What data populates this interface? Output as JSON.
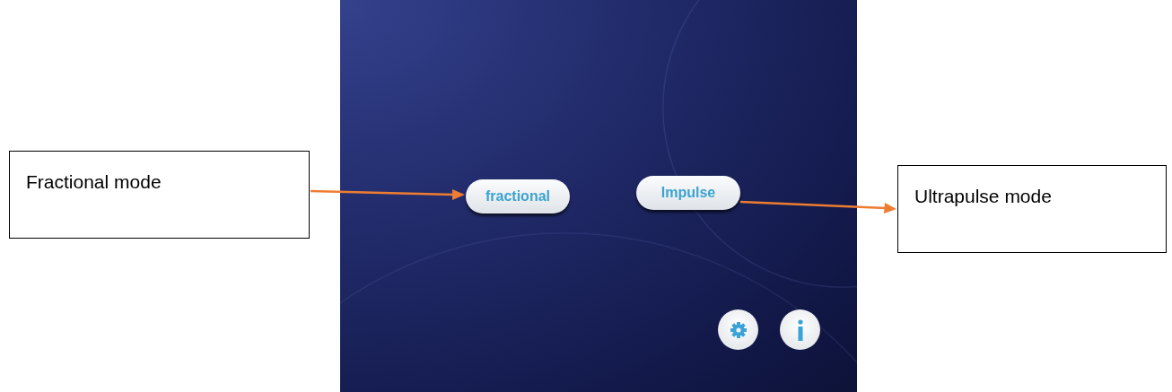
{
  "screen": {
    "buttons": [
      {
        "label": "fractional"
      },
      {
        "label": "Impulse"
      }
    ]
  },
  "callouts": [
    {
      "text": "Fractional mode"
    },
    {
      "text": "Ultrapulse mode"
    }
  ]
}
